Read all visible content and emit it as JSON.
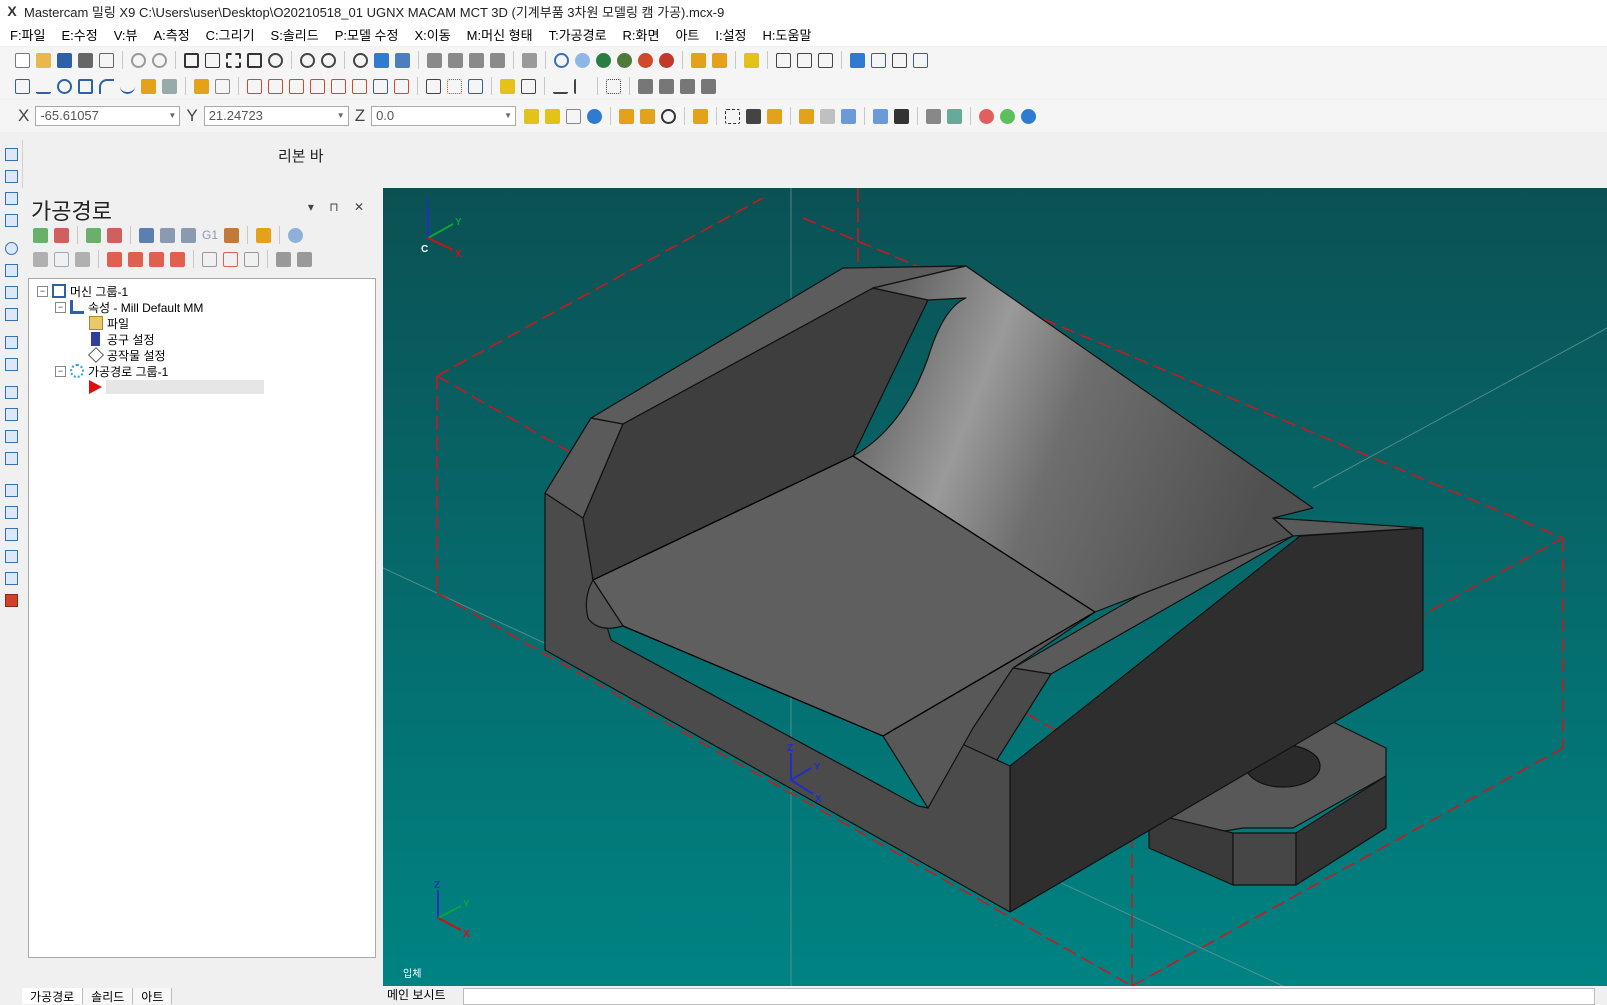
{
  "titlebar": {
    "logo": "X",
    "title": "Mastercam 밀링 X9  C:\\Users\\user\\Desktop\\O20210518_01 UGNX MACAM MCT 3D (기계부품 3차원 모델링 캠 가공).mcx-9"
  },
  "menu": [
    "F:파일",
    "E:수정",
    "V:뷰",
    "A:측정",
    "C:그리기",
    "S:솔리드",
    "P:모델 수정",
    "X:이동",
    "M:머신 형태",
    "T:가공경로",
    "R:화면",
    "아트",
    "I:설정",
    "H:도움말"
  ],
  "coords": {
    "x_label": "X",
    "x_value": "-65.61057",
    "y_label": "Y",
    "y_value": "21.24723",
    "z_label": "Z",
    "z_value": "0.0"
  },
  "ribbon": {
    "label": "리본 바"
  },
  "panel": {
    "title": "가공경로",
    "buttons": "▾ ⊓ ✕",
    "tree": {
      "machine_group": "머신 그룹-1",
      "properties": "속성 - Mill Default MM",
      "files": "파일",
      "tool_settings": "공구 설정",
      "stock_setup": "공작물 설정",
      "toolpath_group": "가공경로 그룹-1"
    },
    "toolbar_g1": "G1",
    "tabs": [
      "가공경로",
      "솔리드",
      "아트"
    ]
  },
  "viewport": {
    "background": "#075d61",
    "view_label": "입체",
    "gnomon_origin_label": "C",
    "axis_x": "X",
    "axis_y": "Y",
    "axis_z": "Z"
  },
  "status": {
    "label": "메인 보시트"
  },
  "colors": {
    "bounding_box": "#d0161a",
    "part": "#4c4c4c"
  }
}
